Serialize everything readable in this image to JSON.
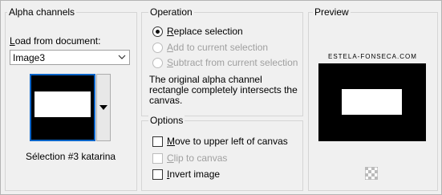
{
  "alpha": {
    "title": "Alpha channels",
    "load_label": "Load from document:",
    "document_value": "Image3",
    "selection_name": "Sélection #3 katarina"
  },
  "operation": {
    "title": "Operation",
    "options": [
      {
        "label": "Replace selection",
        "selected": true,
        "enabled": true
      },
      {
        "label": "Add to current selection",
        "selected": false,
        "enabled": false
      },
      {
        "label": "Subtract from current selection",
        "selected": false,
        "enabled": false
      }
    ],
    "info_line1": "The original alpha channel",
    "info_line2": "rectangle completely intersects the",
    "info_line3": "canvas."
  },
  "options": {
    "title": "Options",
    "move_label": "Move to upper left of canvas",
    "clip_label": "Clip to canvas",
    "invert_label": "Invert image"
  },
  "preview": {
    "title": "Preview",
    "watermark": "ESTELA-FONSECA.COM"
  }
}
